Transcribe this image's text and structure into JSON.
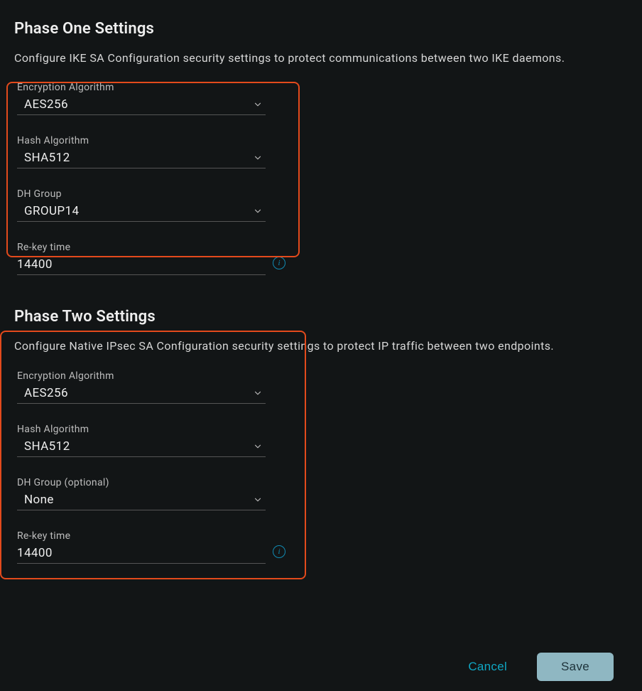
{
  "phase_one": {
    "title": "Phase One Settings",
    "description": "Configure IKE SA Configuration security settings to protect communications between two IKE daemons.",
    "encryption": {
      "label": "Encryption Algorithm",
      "value": "AES256"
    },
    "hash": {
      "label": "Hash Algorithm",
      "value": "SHA512"
    },
    "dh_group": {
      "label": "DH Group",
      "value": "GROUP14"
    },
    "rekey": {
      "label": "Re-key time",
      "value": "14400"
    }
  },
  "phase_two": {
    "title": "Phase Two Settings",
    "description": "Configure Native IPsec SA Configuration security settings to protect IP traffic between two endpoints.",
    "encryption": {
      "label": "Encryption Algorithm",
      "value": "AES256"
    },
    "hash": {
      "label": "Hash Algorithm",
      "value": "SHA512"
    },
    "dh_group": {
      "label": "DH Group (optional)",
      "value": "None"
    },
    "rekey": {
      "label": "Re-key time",
      "value": "14400"
    }
  },
  "footer": {
    "cancel_label": "Cancel",
    "save_label": "Save"
  },
  "icons": {
    "info_glyph": "i"
  }
}
